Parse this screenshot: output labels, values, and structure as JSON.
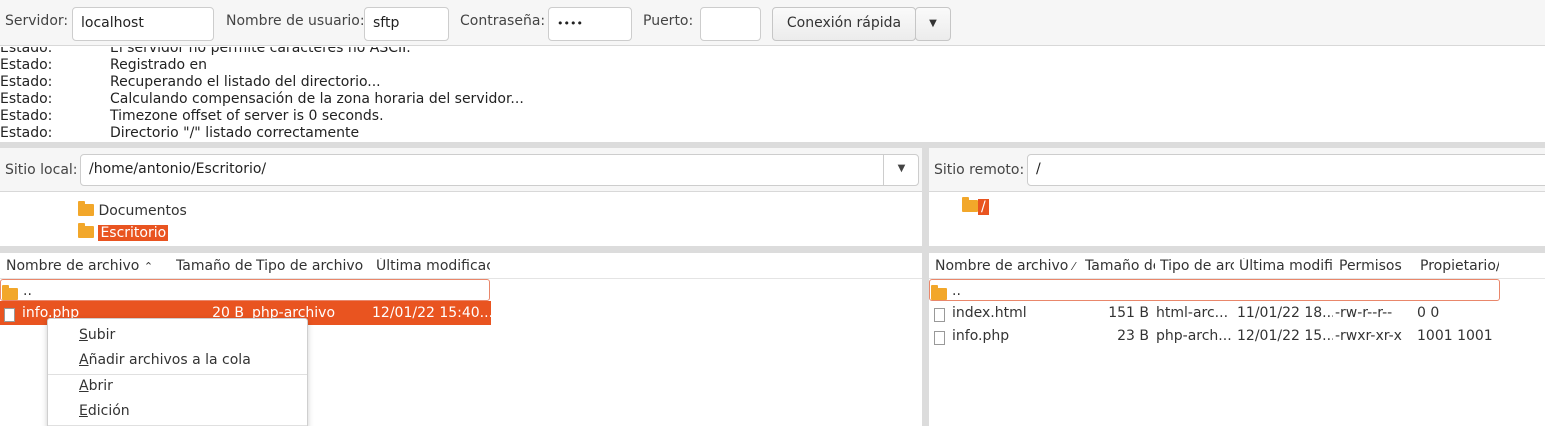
{
  "quickconnect": {
    "host_label": "Servidor:",
    "host_value": "localhost",
    "user_label": "Nombre de usuario:",
    "user_value": "sftp",
    "pass_label": "Contraseña:",
    "pass_value": "••••",
    "port_label": "Puerto:",
    "port_value": "",
    "connect_label": "Conexión rápida"
  },
  "log": [
    {
      "key": "Estado:",
      "value": "El servidor no permite caracteres no ASCII."
    },
    {
      "key": "Estado:",
      "value": "Registrado en"
    },
    {
      "key": "Estado:",
      "value": "Recuperando el listado del directorio..."
    },
    {
      "key": "Estado:",
      "value": "Calculando compensación de la zona horaria del servidor..."
    },
    {
      "key": "Estado:",
      "value": "Timezone offset of server is 0 seconds."
    },
    {
      "key": "Estado:",
      "value": "Directorio \"/\" listado correctamente"
    }
  ],
  "local": {
    "site_label": "Sitio local:",
    "path": "/home/antonio/Escritorio/",
    "tree": [
      "Documentos",
      "Escritorio"
    ],
    "columns": [
      "Nombre de archivo",
      "Tamaño de",
      "Tipo de archivo",
      "Última modificac"
    ],
    "files": [
      {
        "name": "..",
        "size": "",
        "type": "",
        "modified": ""
      },
      {
        "name": "info.php",
        "size": "20 B",
        "type": "php-archivo",
        "modified": "12/01/22 15:40..."
      }
    ]
  },
  "remote": {
    "site_label": "Sitio remoto:",
    "path": "/",
    "tree": [
      "/"
    ],
    "columns": [
      "Nombre de archivo",
      "Tamaño de",
      "Tipo de arc",
      "Última modifi",
      "Permisos",
      "Propietario/"
    ],
    "files": [
      {
        "name": "..",
        "size": "",
        "type": "",
        "modified": "",
        "perms": "",
        "owner": ""
      },
      {
        "name": "index.html",
        "size": "151 B",
        "type": "html-arc...",
        "modified": "11/01/22 18...",
        "perms": "-rw-r--r--",
        "owner": "0 0"
      },
      {
        "name": "info.php",
        "size": "23 B",
        "type": "php-arch...",
        "modified": "12/01/22 15...",
        "perms": "-rwxr-xr-x",
        "owner": "1001 1001"
      }
    ]
  },
  "context_menu": {
    "upload": {
      "accel": "S",
      "rest": "ubir"
    },
    "queue": {
      "accel": "A",
      "rest": "ñadir archivos a la cola"
    },
    "open": {
      "accel": "A",
      "rest": "brir"
    },
    "edit": {
      "accel": "E",
      "rest": "dición"
    }
  },
  "colors": {
    "accent": "#e95420",
    "folder": "#f2a72a"
  }
}
